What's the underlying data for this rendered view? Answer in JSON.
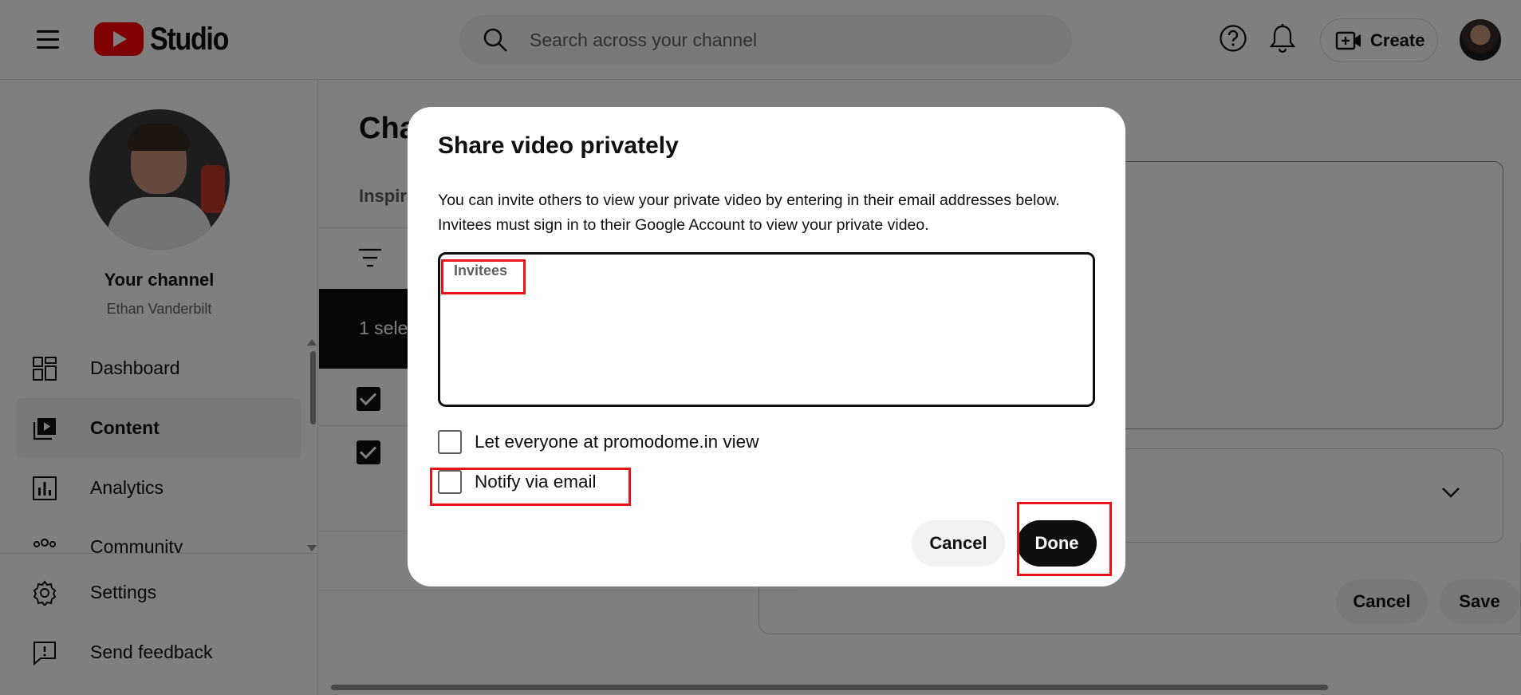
{
  "topbar": {
    "logo_text": "Studio",
    "search_placeholder": "Search across your channel",
    "create_label": "Create"
  },
  "sidebar": {
    "channel_title": "Your channel",
    "channel_handle": "Ethan Vanderbilt",
    "items": [
      {
        "label": "Dashboard",
        "icon": "dashboard-icon"
      },
      {
        "label": "Content",
        "icon": "content-icon",
        "active": true
      },
      {
        "label": "Analytics",
        "icon": "analytics-icon"
      },
      {
        "label": "Community",
        "icon": "community-icon"
      }
    ],
    "bottom_items": [
      {
        "label": "Settings",
        "icon": "gear-icon"
      },
      {
        "label": "Send feedback",
        "icon": "feedback-icon"
      }
    ]
  },
  "main": {
    "title_partial": "Cha",
    "tab_partial": "Inspira",
    "selection_partial": "1 sele",
    "panel_cancel": "Cancel",
    "panel_save": "Save"
  },
  "modal": {
    "title": "Share video privately",
    "description": "You can invite others to view your private video by entering in their email addresses below. Invitees must sign in to their Google Account to view your private video.",
    "invitees_label": "Invitees",
    "option_everyone": "Let everyone at promodome.in view",
    "option_notify": "Notify via email",
    "cancel_label": "Cancel",
    "done_label": "Done"
  },
  "colors": {
    "brand_red": "#ff0000",
    "annotation_red": "#e8121b",
    "primary_text": "#0f0f0f",
    "secondary_text": "#606060"
  }
}
